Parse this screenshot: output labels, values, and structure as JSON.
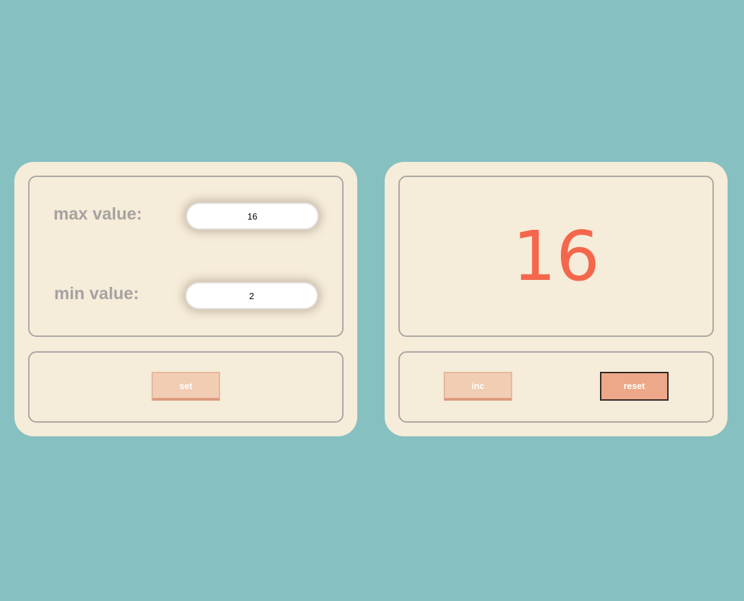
{
  "settings": {
    "max_label": "max value:",
    "max_value": "16",
    "min_label": "min value:",
    "min_value": "2",
    "set_label": "set"
  },
  "counter": {
    "display_value": "16",
    "inc_label": "inc",
    "reset_label": "reset"
  },
  "colors": {
    "background": "#87c0c0",
    "panel": "#f5ecd9",
    "display": "#f4674c",
    "button_disabled": "#f1cdb4",
    "button_active": "#eca888"
  }
}
